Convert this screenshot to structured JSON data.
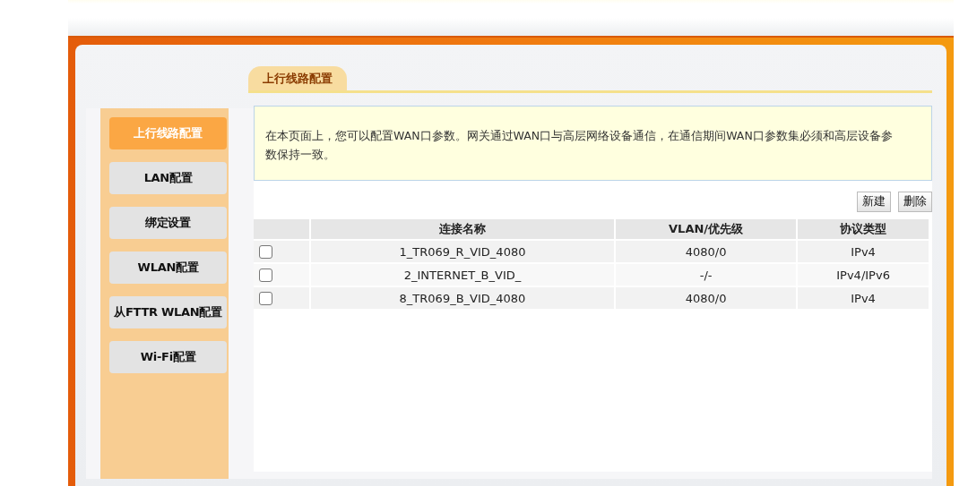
{
  "tabs": [
    {
      "label": "上行线路配置",
      "selected": true
    }
  ],
  "sidebar": {
    "items": [
      {
        "label": "上行线路配置",
        "selected": true
      },
      {
        "label": "LAN配置",
        "selected": false
      },
      {
        "label": "绑定设置",
        "selected": false
      },
      {
        "label": "WLAN配置",
        "selected": false
      },
      {
        "label": "从FTTR WLAN配置",
        "selected": false
      },
      {
        "label": "Wi-Fi配置",
        "selected": false
      }
    ]
  },
  "notice": "在本页面上，您可以配置WAN口参数。网关通过WAN口与高层网络设备通信，在通信期间WAN口参数集必须和高层设备参数保持一致。",
  "buttons": [
    "新建",
    "删除"
  ],
  "table": {
    "columns": [
      "连接名称",
      "VLAN/优先级",
      "协议类型"
    ],
    "rows": [
      {
        "checked": false,
        "cells": [
          "1_TR069_R_VID_4080",
          "4080/0",
          "IPv4"
        ]
      },
      {
        "checked": false,
        "cells": [
          "2_INTERNET_B_VID_",
          "-/-",
          "IPv4/IPv6"
        ]
      },
      {
        "checked": false,
        "cells": [
          "8_TR069_B_VID_4080",
          "4080/0",
          "IPv4"
        ]
      }
    ]
  }
}
